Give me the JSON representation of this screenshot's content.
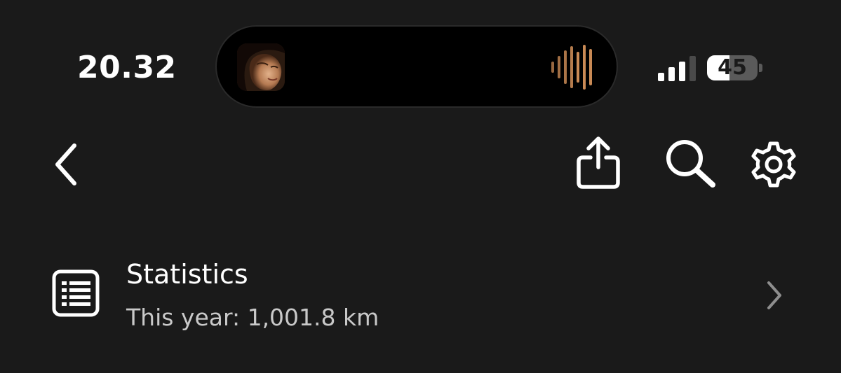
{
  "colors": {
    "background": "#1a1a1a",
    "text_primary": "#ffffff",
    "text_secondary": "#c9c9c9",
    "chevron": "#8e8e8e",
    "island": "#000000",
    "wave_accent": "#c98a55"
  },
  "status_bar": {
    "time": "20.32",
    "signal_bars_active": 3,
    "signal_bars_total": 4,
    "battery_level": "45",
    "battery_fraction": 0.45
  },
  "dynamic_island": {
    "album_art_icon": "album-art-thumbnail",
    "activity_icon": "audio-waveform-icon"
  },
  "nav": {
    "back_icon": "chevron-left-icon",
    "share_icon": "share-icon",
    "search_icon": "search-icon",
    "settings_icon": "gear-icon"
  },
  "statistics": {
    "icon": "list-document-icon",
    "title": "Statistics",
    "subtitle": "This year: 1,001.8 km",
    "disclosure_icon": "chevron-right-icon"
  }
}
